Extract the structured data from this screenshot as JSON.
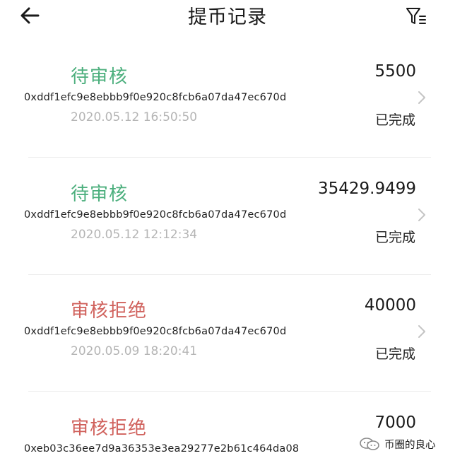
{
  "header": {
    "title": "提币记录"
  },
  "records": [
    {
      "status": "待审核",
      "status_color": "#4caf7d",
      "amount": "5500",
      "address": "0xddf1efc9e8ebbb9f0e920c8fcb6a07da47ec670d",
      "time": "2020.05.12 16:50:50",
      "state": "已完成"
    },
    {
      "status": "待审核",
      "status_color": "#4caf7d",
      "amount": "35429.9499",
      "address": "0xddf1efc9e8ebbb9f0e920c8fcb6a07da47ec670d",
      "time": "2020.05.12 12:12:34",
      "state": "已完成"
    },
    {
      "status": "审核拒绝",
      "status_color": "#d0615c",
      "amount": "40000",
      "address": "0xddf1efc9e8ebbb9f0e920c8fcb6a07da47ec670d",
      "time": "2020.05.09 18:20:41",
      "state": "已完成"
    },
    {
      "status": "审核拒绝",
      "status_color": "#d0615c",
      "amount": "7000",
      "address": "0xeb03c36ee7d9a36353e3ea29277e2b61c464da08"
    }
  ],
  "watermark": {
    "text": "币圈的良心",
    "icon": "wechat-icon"
  }
}
